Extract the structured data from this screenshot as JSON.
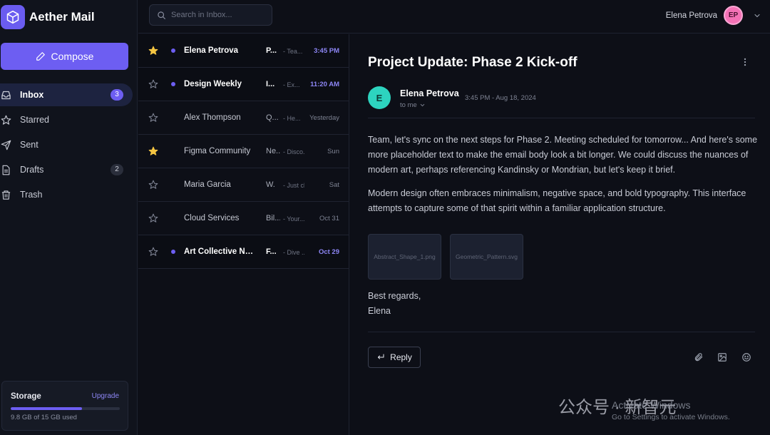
{
  "app": {
    "name": "Aether Mail"
  },
  "sidebar": {
    "compose_label": "Compose",
    "items": [
      {
        "label": "Inbox",
        "badge": "3",
        "icon": "inbox-icon",
        "active": true
      },
      {
        "label": "Starred",
        "badge": "",
        "icon": "star-icon"
      },
      {
        "label": "Sent",
        "badge": "",
        "icon": "send-icon"
      },
      {
        "label": "Drafts",
        "badge": "2",
        "icon": "file-icon"
      },
      {
        "label": "Trash",
        "badge": "",
        "icon": "trash-icon"
      }
    ],
    "storage": {
      "title": "Storage",
      "link": "Upgrade",
      "used_text": "9.8 GB of 15 GB used",
      "used_fraction": 0.653
    }
  },
  "header": {
    "search_placeholder": "Search in Inbox...",
    "user_name": "Elena Petrova",
    "user_initials": "EP"
  },
  "emails": [
    {
      "sender": "Elena Petrova",
      "subject": "P...",
      "snippet": "- Tea...",
      "time": "3:45 PM",
      "starred": true,
      "unread": true
    },
    {
      "sender": "Design Weekly",
      "subject": "I...",
      "snippet": "- Ex...",
      "time": "11:20 AM",
      "starred": false,
      "unread": true
    },
    {
      "sender": "Alex Thompson",
      "subject": "Q...",
      "snippet": "- He...",
      "time": "Yesterday",
      "starred": false,
      "unread": false
    },
    {
      "sender": "Figma Community",
      "subject": "Ne...",
      "snippet": "- Disco...",
      "time": "Sun",
      "starred": true,
      "unread": false
    },
    {
      "sender": "Maria Garcia",
      "subject": "W.",
      "snippet": "- Just check...",
      "time": "Sat",
      "starred": false,
      "unread": false
    },
    {
      "sender": "Cloud Services",
      "subject": "Bil...",
      "snippet": "- Your...",
      "time": "Oct 31",
      "starred": false,
      "unread": false
    },
    {
      "sender": "Art Collective Ne...",
      "subject": "F...",
      "snippet": "- Dive ...",
      "time": "Oct 29",
      "starred": false,
      "unread": true
    }
  ],
  "message": {
    "subject": "Project Update: Phase 2 Kick-off",
    "from_initial": "E",
    "from_name": "Elena Petrova",
    "date": "3:45 PM - Aug 18, 2024",
    "to": "to me",
    "paragraphs": [
      "Team, let's sync on the next steps for Phase 2. Meeting scheduled for tomorrow... And here's some more placeholder text to make the email body look a bit longer. We could discuss the nuances of modern art, perhaps referencing Kandinsky or Mondrian, but let's keep it brief.",
      "Modern design often embraces minimalism, negative space, and bold typography. This interface attempts to capture some of that spirit within a familiar application structure."
    ],
    "attachments": [
      "Abstract_Shape_1.png",
      "Geometric_Pattern.svg"
    ],
    "closing": "Best regards,",
    "signature": "Elena",
    "reply_label": "Reply"
  },
  "watermark": {
    "brand": "公众号 · 新智元",
    "activate_title": "Activate Windows",
    "activate_sub": "Go to Settings to activate Windows."
  },
  "colors": {
    "accent": "#6d5ef2",
    "star": "#f5c542",
    "avatar_top": "#f472b6",
    "avatar_sender": "#2dd4bf"
  }
}
